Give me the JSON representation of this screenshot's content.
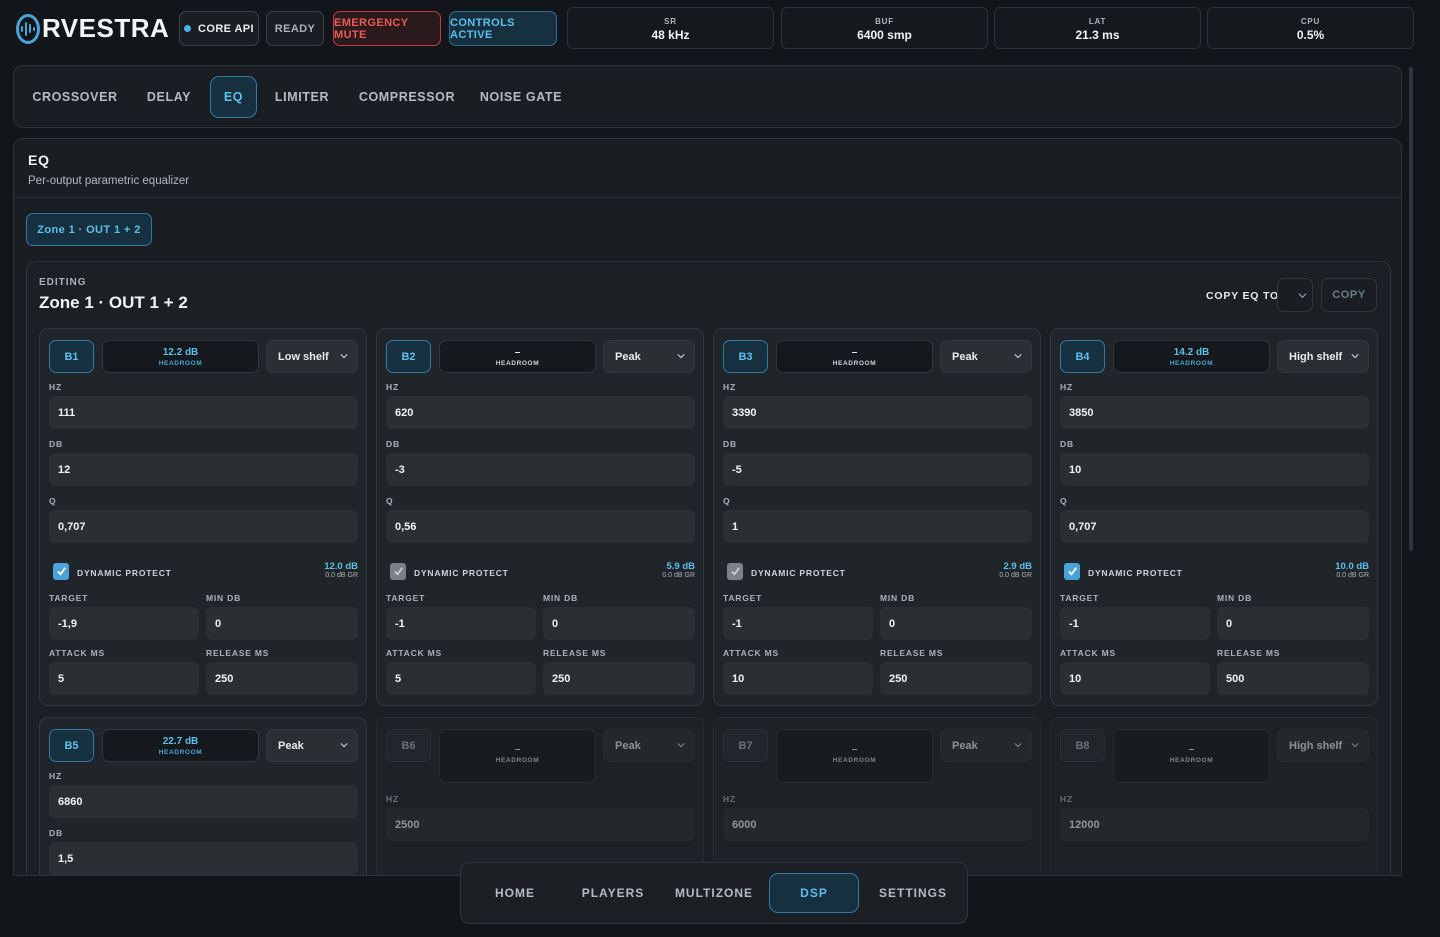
{
  "header": {
    "logo_text": "RVESTRA",
    "core_api": "CORE API",
    "ready": "READY",
    "emergency": "EMERGENCY MUTE",
    "controls": "CONTROLS ACTIVE",
    "stats": [
      {
        "label": "SR",
        "value": "48 kHz"
      },
      {
        "label": "BUF",
        "value": "6400 smp"
      },
      {
        "label": "LAT",
        "value": "21.3 ms"
      },
      {
        "label": "CPU",
        "value": "0.5%"
      }
    ]
  },
  "tabs": [
    "CROSSOVER",
    "DELAY",
    "EQ",
    "LIMITER",
    "COMPRESSOR",
    "NOISE GATE"
  ],
  "active_tab": "EQ",
  "panel": {
    "title": "EQ",
    "subtitle": "Per-output parametric equalizer",
    "zone_chip": "Zone 1 · OUT 1 + 2",
    "editing_label": "EDITING",
    "editing_title": "Zone 1 · OUT 1 + 2",
    "copy_label": "COPY EQ TO",
    "copy_button": "COPY"
  },
  "labels": {
    "headroom": "HEADROOM",
    "hz": "HZ",
    "db": "DB",
    "q": "Q",
    "dynamic_protect": "DYNAMIC PROTECT",
    "target": "TARGET",
    "min_db": "MIN DB",
    "attack_ms": "ATTACK MS",
    "release_ms": "RELEASE MS"
  },
  "bands": [
    {
      "id": "B1",
      "headroom": "12.2 dB",
      "type": "Low shelf",
      "hz": "111",
      "db": "12",
      "q": "0,707",
      "protect": true,
      "protect_db": "12.0 dB",
      "protect_gr": "0.0 dB GR",
      "target": "-1,9",
      "min_db": "0",
      "attack": "5",
      "release": "250"
    },
    {
      "id": "B2",
      "headroom": "–",
      "type": "Peak",
      "hz": "620",
      "db": "-3",
      "q": "0,56",
      "protect": false,
      "protect_db": "5.9 dB",
      "protect_gr": "0.0 dB GR",
      "target": "-1",
      "min_db": "0",
      "attack": "5",
      "release": "250"
    },
    {
      "id": "B3",
      "headroom": "–",
      "type": "Peak",
      "hz": "3390",
      "db": "-5",
      "q": "1",
      "protect": false,
      "protect_db": "2.9 dB",
      "protect_gr": "0.0 dB GR",
      "target": "-1",
      "min_db": "0",
      "attack": "10",
      "release": "250"
    },
    {
      "id": "B4",
      "headroom": "14.2 dB",
      "type": "High shelf",
      "hz": "3850",
      "db": "10",
      "q": "0,707",
      "protect": true,
      "protect_db": "10.0 dB",
      "protect_gr": "0.0 dB GR",
      "target": "-1",
      "min_db": "0",
      "attack": "10",
      "release": "500"
    },
    {
      "id": "B5",
      "headroom": "22.7 dB",
      "type": "Peak",
      "hz": "6860",
      "db": "1,5"
    },
    {
      "id": "B6",
      "headroom": "–",
      "type": "Peak",
      "hz": "2500"
    },
    {
      "id": "B7",
      "headroom": "–",
      "type": "Peak",
      "hz": "6000"
    },
    {
      "id": "B8",
      "headroom": "–",
      "type": "High shelf",
      "hz": "12000"
    }
  ],
  "nav": [
    "HOME",
    "PLAYERS",
    "MULTIZONE",
    "DSP",
    "SETTINGS"
  ],
  "active_nav": "DSP",
  "colors": {
    "accent": "#4aa3d8",
    "danger": "#ee5a5a",
    "background": "#121519"
  }
}
